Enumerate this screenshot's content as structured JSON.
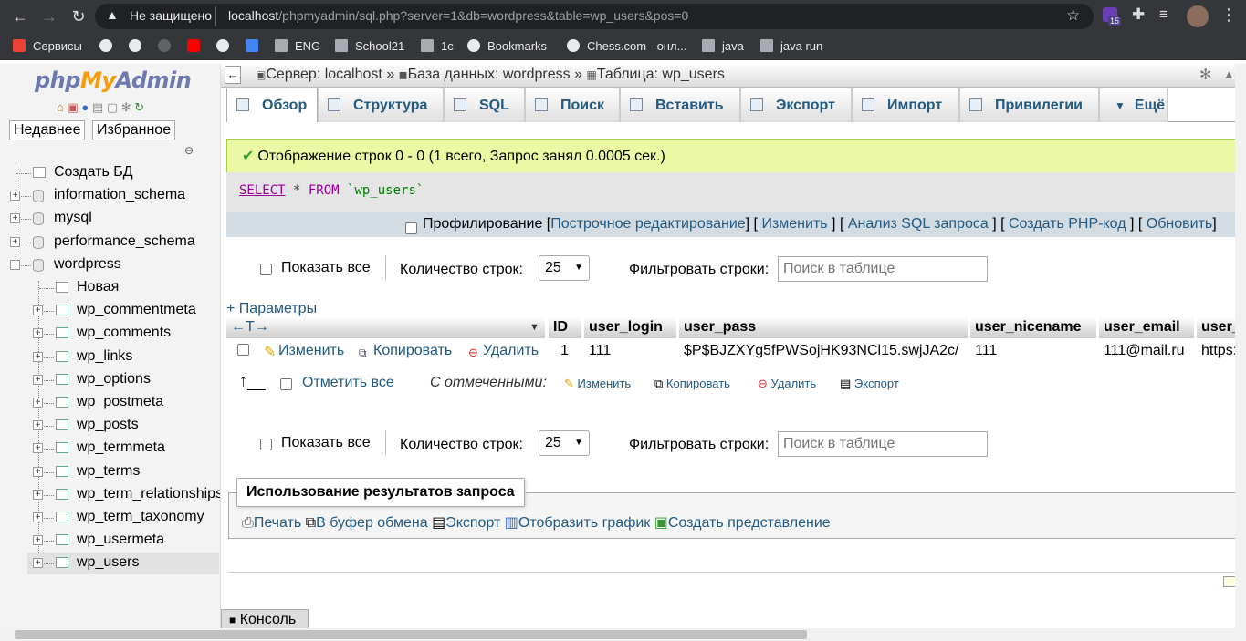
{
  "browser": {
    "security": "Не защищено",
    "url_host": "localhost",
    "url_path": "/phpmyadmin/sql.php?server=1&db=wordpress&table=wp_users&pos=0",
    "badge_count": "15",
    "bookmarks": [
      {
        "label": "Сервисы",
        "icon": "apps-grid-icon"
      },
      {
        "label": "",
        "icon": "globe-icon"
      },
      {
        "label": "",
        "icon": "globe-icon"
      },
      {
        "label": "",
        "icon": "github-icon"
      },
      {
        "label": "",
        "icon": "youtube-icon"
      },
      {
        "label": "",
        "icon": "globe-icon"
      },
      {
        "label": "",
        "icon": "translate-icon"
      },
      {
        "label": "ENG",
        "icon": "folder-icon"
      },
      {
        "label": "School21",
        "icon": "folder-icon"
      },
      {
        "label": "1c",
        "icon": "folder-icon"
      },
      {
        "label": "Bookmarks",
        "icon": "globe-icon"
      },
      {
        "label": "Chess.com - онл...",
        "icon": "globe-icon"
      },
      {
        "label": "java",
        "icon": "folder-icon"
      },
      {
        "label": "java run",
        "icon": "folder-icon"
      }
    ]
  },
  "sidebar": {
    "logo": {
      "php": "php",
      "my": "My",
      "admin": "Admin"
    },
    "tabs": [
      "Недавнее",
      "Избранное"
    ],
    "tree": [
      {
        "label": "Создать БД",
        "level": 0,
        "type": "new"
      },
      {
        "label": "information_schema",
        "level": 0,
        "type": "db"
      },
      {
        "label": "mysql",
        "level": 0,
        "type": "db"
      },
      {
        "label": "performance_schema",
        "level": 0,
        "type": "db"
      },
      {
        "label": "wordpress",
        "level": 0,
        "type": "db-open"
      },
      {
        "label": "Новая",
        "level": 1,
        "type": "new"
      },
      {
        "label": "wp_commentmeta",
        "level": 1,
        "type": "table"
      },
      {
        "label": "wp_comments",
        "level": 1,
        "type": "table"
      },
      {
        "label": "wp_links",
        "level": 1,
        "type": "table"
      },
      {
        "label": "wp_options",
        "level": 1,
        "type": "table"
      },
      {
        "label": "wp_postmeta",
        "level": 1,
        "type": "table"
      },
      {
        "label": "wp_posts",
        "level": 1,
        "type": "table"
      },
      {
        "label": "wp_termmeta",
        "level": 1,
        "type": "table"
      },
      {
        "label": "wp_terms",
        "level": 1,
        "type": "table"
      },
      {
        "label": "wp_term_relationships",
        "level": 1,
        "type": "table"
      },
      {
        "label": "wp_term_taxonomy",
        "level": 1,
        "type": "table"
      },
      {
        "label": "wp_usermeta",
        "level": 1,
        "type": "table"
      },
      {
        "label": "wp_users",
        "level": 1,
        "type": "table",
        "selected": true
      }
    ]
  },
  "breadcrumb": {
    "server": "Сервер: localhost",
    "database": "База данных: wordpress",
    "table": "Таблица: wp_users",
    "sep": "»"
  },
  "tabs": [
    "Обзор",
    "Структура",
    "SQL",
    "Поиск",
    "Вставить",
    "Экспорт",
    "Импорт",
    "Привилегии",
    "Ещё"
  ],
  "message": {
    "success": "Отображение строк 0 - 0 (1 всего, Запрос занял 0.0005 сек.)",
    "sql_select": "SELECT",
    "sql_star": " * ",
    "sql_from": "FROM",
    "sql_table": " `wp_users`"
  },
  "query_tools": {
    "profiling": "Профилирование",
    "inline_edit": "Построчное редактирование",
    "edit": "Изменить",
    "explain": "Анализ SQL запроса",
    "create_php": "Создать PHP-код",
    "refresh": "Обновить"
  },
  "controls": {
    "show_all": "Показать все",
    "rows_label": "Количество строк:",
    "rows_value": "25",
    "filter_label": "Фильтровать строки:",
    "filter_placeholder": "Поиск в таблице"
  },
  "options_link": "+ Параметры",
  "table": {
    "arrows": "←T→",
    "headers": [
      "ID",
      "user_login",
      "user_pass",
      "user_nicename",
      "user_email",
      "user_u"
    ],
    "row": {
      "edit": "Изменить",
      "copy": "Копировать",
      "delete": "Удалить",
      "cells": [
        "1",
        "111",
        "$P$BJZXYg5fPWSojHK93NCl15.swjJA2c/",
        "111",
        "111@mail.ru",
        "https://"
      ]
    }
  },
  "bulk": {
    "check_all": "Отметить все",
    "with_selected": "С отмеченными:",
    "edit": "Изменить",
    "copy": "Копировать",
    "delete": "Удалить",
    "export": "Экспорт"
  },
  "usage": {
    "legend": "Использование результатов запроса",
    "print": "Печать",
    "clipboard": "В буфер обмена",
    "export": "Экспорт",
    "chart": "Отобразить график",
    "create_view": "Создать представление"
  },
  "console": "Консоль"
}
